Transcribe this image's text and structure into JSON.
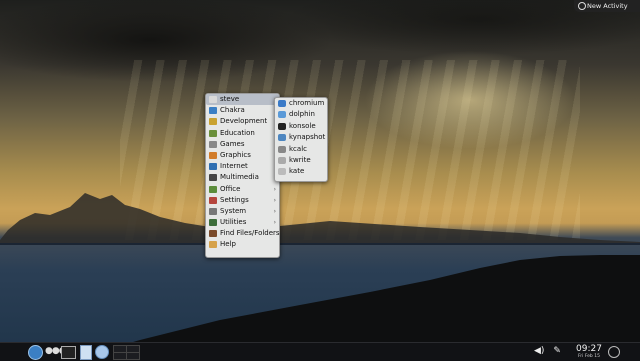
{
  "top_right": {
    "new_activity_label": "New Activity",
    "icon": "activity-sun-icon"
  },
  "menu": {
    "items": [
      {
        "label": "steve",
        "icon": "home-folder-icon",
        "color": "#d9d9d9",
        "submenu": true,
        "active": true
      },
      {
        "label": "Chakra",
        "icon": "chakra-icon",
        "color": "#3b7fc4",
        "submenu": true
      },
      {
        "label": "Development",
        "icon": "development-icon",
        "color": "#c9a230",
        "submenu": true
      },
      {
        "label": "Education",
        "icon": "education-icon",
        "color": "#6a8f3a",
        "submenu": true
      },
      {
        "label": "Games",
        "icon": "games-icon",
        "color": "#888",
        "submenu": true
      },
      {
        "label": "Graphics",
        "icon": "graphics-icon",
        "color": "#d27c2a",
        "submenu": true
      },
      {
        "label": "Internet",
        "icon": "internet-globe-icon",
        "color": "#2f6fb2",
        "submenu": true
      },
      {
        "label": "Multimedia",
        "icon": "multimedia-icon",
        "color": "#444",
        "submenu": true
      },
      {
        "label": "Office",
        "icon": "office-icon",
        "color": "#5b8c3a",
        "submenu": true
      },
      {
        "label": "Settings",
        "icon": "settings-icon",
        "color": "#b5453d",
        "submenu": true
      },
      {
        "label": "System",
        "icon": "system-icon",
        "color": "#777",
        "submenu": true
      },
      {
        "label": "Utilities",
        "icon": "utilities-icon",
        "color": "#3c6d3a",
        "submenu": true
      },
      {
        "label": "Find Files/Folders",
        "icon": "find-files-icon",
        "color": "#7a4a2a",
        "submenu": false
      },
      {
        "label": "Help",
        "icon": "help-icon",
        "color": "#d6a24a",
        "submenu": false
      }
    ]
  },
  "submenu": {
    "items": [
      {
        "label": "chromium",
        "icon": "chromium-icon",
        "color": "#3a7ac7"
      },
      {
        "label": "dolphin",
        "icon": "dolphin-icon",
        "color": "#5a9ad8"
      },
      {
        "label": "konsole",
        "icon": "konsole-icon",
        "color": "#222"
      },
      {
        "label": "kynapshot",
        "icon": "ksnapshot-icon",
        "color": "#4d86c0"
      },
      {
        "label": "kcalc",
        "icon": "kcalc-icon",
        "color": "#888"
      },
      {
        "label": "kwrite",
        "icon": "kwrite-icon",
        "color": "#aaa"
      },
      {
        "label": "kate",
        "icon": "kate-icon",
        "color": "#bbb"
      }
    ]
  },
  "panel": {
    "time": "09:27",
    "date": "Fri Feb 15",
    "dots": "●●●",
    "icons": [
      "kickoff-launcher-icon",
      "activity-dots-icon",
      "terminal-icon",
      "document-icon",
      "disc-icon",
      "pager-icon",
      "volume-icon",
      "network-icon",
      "cashew-icon"
    ]
  }
}
